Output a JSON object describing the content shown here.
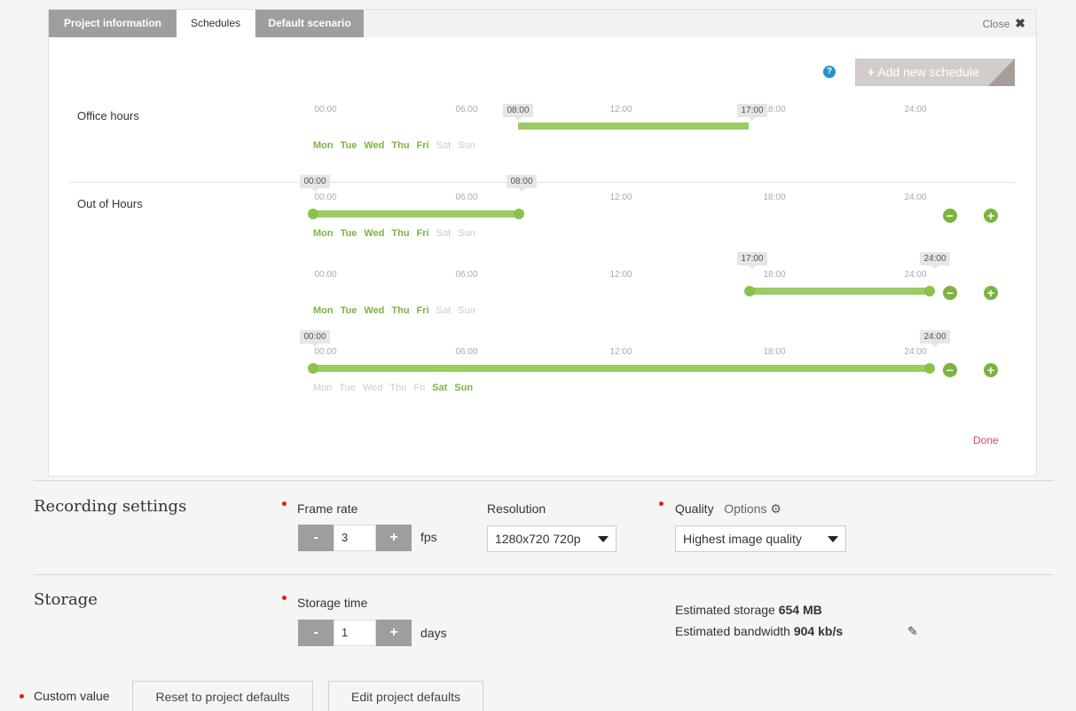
{
  "tabs": [
    {
      "label": "Project information"
    },
    {
      "label": "Schedules"
    },
    {
      "label": "Default scenario"
    }
  ],
  "close_label": "Close",
  "help_glyph": "?",
  "add_schedule_label": "Add new schedule",
  "done_label": "Done",
  "ticks": [
    "00:00",
    "06:00",
    "12:00",
    "18:00",
    "24:00"
  ],
  "weekdays": [
    "Mon",
    "Tue",
    "Wed",
    "Thu",
    "Fri",
    "Sat",
    "Sun"
  ],
  "schedules": [
    {
      "name": "Office hours",
      "ranges": [
        {
          "start": "08:00",
          "end": "17:00",
          "active_days": [
            "Mon",
            "Tue",
            "Wed",
            "Thu",
            "Fri"
          ]
        }
      ]
    },
    {
      "name": "Out of Hours",
      "ranges": [
        {
          "start": "00:00",
          "end": "08:00",
          "active_days": [
            "Mon",
            "Tue",
            "Wed",
            "Thu",
            "Fri"
          ]
        },
        {
          "start": "17:00",
          "end": "24:00",
          "active_days": [
            "Mon",
            "Tue",
            "Wed",
            "Thu",
            "Fri"
          ]
        },
        {
          "start": "00:00",
          "end": "24:00",
          "active_days": [
            "Sat",
            "Sun"
          ]
        }
      ]
    }
  ],
  "recording": {
    "title": "Recording settings",
    "frame_rate_label": "Frame rate",
    "frame_rate_value": "3",
    "frame_rate_unit": "fps",
    "resolution_label": "Resolution",
    "resolution_value": "1280x720 720p",
    "quality_label": "Quality",
    "options_label": "Options",
    "quality_value": "Highest image quality"
  },
  "storage": {
    "title": "Storage",
    "time_label": "Storage time",
    "time_value": "1",
    "time_unit": "days",
    "estimated_storage_label": "Estimated storage",
    "estimated_storage_value": "654 MB",
    "estimated_bandwidth_label": "Estimated bandwidth",
    "estimated_bandwidth_value": "904 kb/s"
  },
  "footer": {
    "custom_value_label": "Custom value",
    "reset_label": "Reset to project defaults",
    "edit_label": "Edit project defaults"
  },
  "colors": {
    "accent_green": "#8bc34a",
    "required_red": "#e02020",
    "done_red": "#e0475e",
    "help_blue": "#2a8fd0"
  }
}
